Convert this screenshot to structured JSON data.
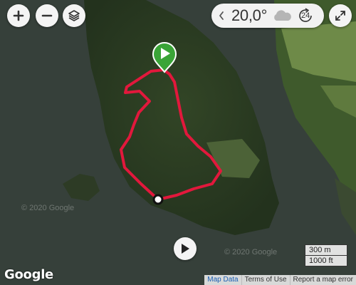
{
  "map": {
    "copyright_text": "© 2020 Google",
    "colors": {
      "water": "#36403a",
      "forest": "#2b3a24",
      "field": "#6e8a48",
      "route": "#e2183c",
      "start_marker": "#3aa437"
    }
  },
  "controls": {
    "zoom_in_icon": "plus-icon",
    "zoom_out_icon": "minus-icon",
    "layers_icon": "layers-icon",
    "fullscreen_icon": "expand-icon",
    "play_icon": "play-icon"
  },
  "weather": {
    "temperature": "20,0°",
    "condition_icon": "cloud-icon",
    "forecast_hours": "24"
  },
  "scale": {
    "metric": "300 m",
    "imperial": "1000 ft"
  },
  "branding": {
    "logo_text": "Google"
  },
  "attribution": {
    "map_data": "Map Data",
    "terms": "Terms of Use",
    "report": "Report a map error"
  }
}
